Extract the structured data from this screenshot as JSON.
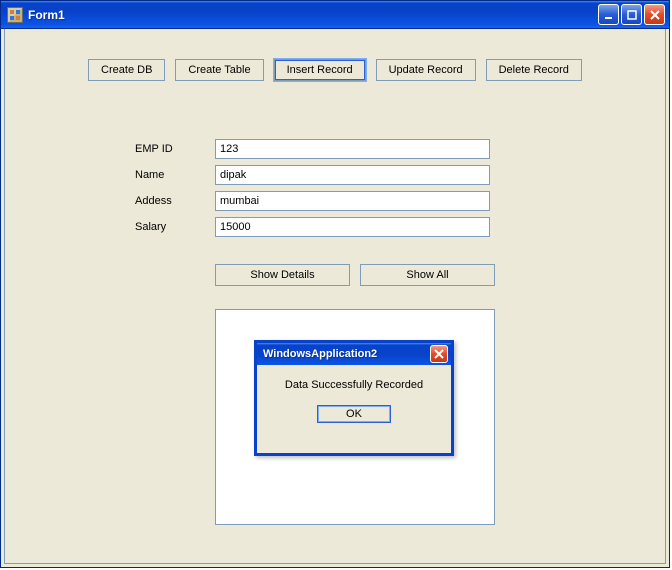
{
  "window": {
    "title": "Form1"
  },
  "toolbar": {
    "create_db": "Create DB",
    "create_table": "Create Table",
    "insert_record": "Insert Record",
    "update_record": "Update Record",
    "delete_record": "Delete Record"
  },
  "form": {
    "emp_id": {
      "label": "EMP ID",
      "value": "123"
    },
    "name": {
      "label": "Name",
      "value": "dipak"
    },
    "address": {
      "label": "Addess",
      "value": "mumbai"
    },
    "salary": {
      "label": "Salary",
      "value": "15000"
    }
  },
  "actions": {
    "show_details": "Show Details",
    "show_all": "Show All"
  },
  "msgbox": {
    "title": "WindowsApplication2",
    "message": "Data Successfully Recorded",
    "ok": "OK"
  }
}
